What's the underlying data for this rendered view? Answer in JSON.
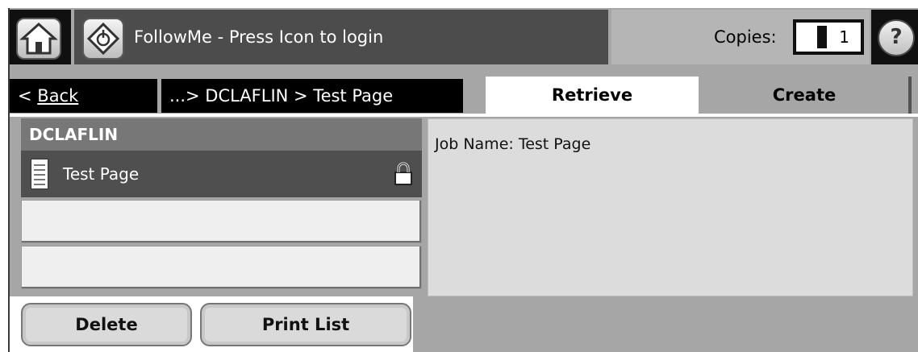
{
  "header": {
    "title": "FollowMe - Press Icon to login",
    "copies_label": "Copies:",
    "copies_value": "1",
    "help_label": "?"
  },
  "tabs": {
    "back_prefix": "< ",
    "back_label": "Back",
    "breadcrumb": "...> DCLAFLIN > Test Page",
    "retrieve": "Retrieve",
    "create": "Create"
  },
  "list": {
    "header": "DCLAFLIN",
    "items": [
      {
        "label": "Test Page",
        "selected": true,
        "locked": true
      }
    ]
  },
  "detail": {
    "job_name": "Job Name: Test Page"
  },
  "buttons": {
    "delete": "Delete",
    "print_list": "Print List"
  }
}
